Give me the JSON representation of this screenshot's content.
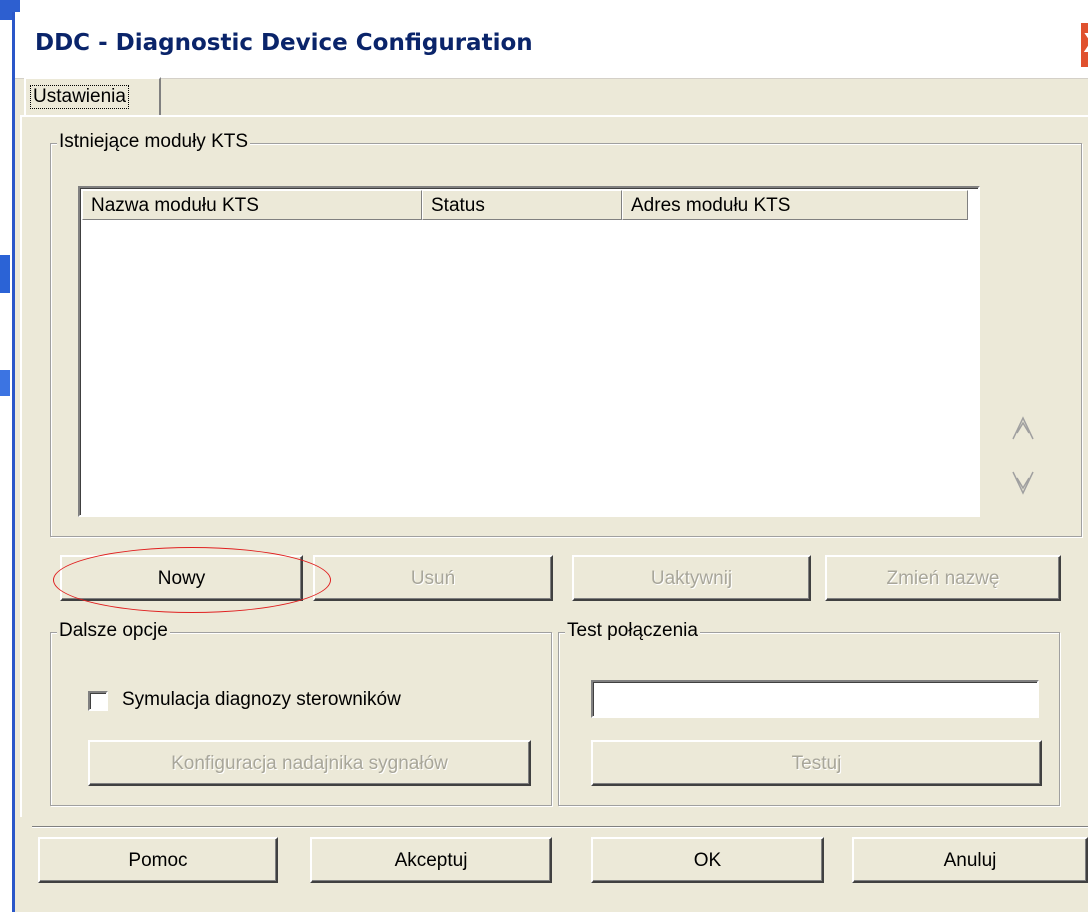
{
  "window": {
    "title": "DDC - Diagnostic Device Configuration",
    "close_glyph": "X"
  },
  "tabs": [
    {
      "label": "Ustawienia"
    }
  ],
  "modules_group": {
    "label": "Istniejące moduły KTS",
    "columns": [
      "Nazwa modułu KTS",
      "Status",
      "Adres modułu KTS"
    ],
    "rows": []
  },
  "module_buttons": {
    "new": "Nowy",
    "delete": "Usuń",
    "activate": "Uaktywnij",
    "rename": "Zmień nazwę"
  },
  "options_group": {
    "label": "Dalsze opcje",
    "simulation_label": "Symulacja diagnozy sterowników",
    "simulation_checked": false,
    "signal_config_button": "Konfiguracja nadajnika sygnałów"
  },
  "test_group": {
    "label": "Test połączenia",
    "result_value": "",
    "test_button": "Testuj"
  },
  "footer_buttons": {
    "help": "Pomoc",
    "accept": "Akceptuj",
    "ok": "OK",
    "cancel": "Anuluj"
  },
  "icons": {
    "scroll_up": "scroll-up-icon",
    "scroll_down": "scroll-down-icon",
    "close": "close-icon"
  },
  "colors": {
    "dialog_bg": "#ece9d8",
    "title_text": "#0a246a",
    "highlight_ellipse": "#e02020",
    "close_button": "#e0512e"
  }
}
